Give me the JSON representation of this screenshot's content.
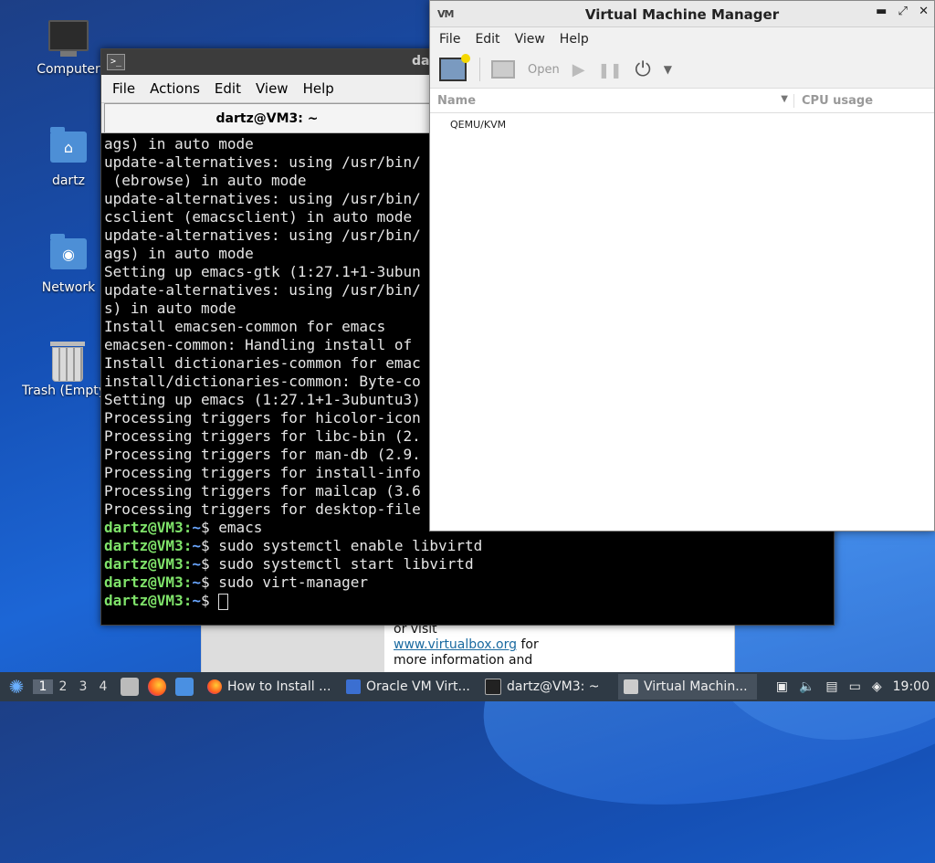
{
  "desktop": {
    "icons": [
      {
        "label": "Computer"
      },
      {
        "label": "dartz"
      },
      {
        "label": "Network"
      },
      {
        "label": "Trash (Empty)"
      }
    ]
  },
  "terminal": {
    "window_title": "dartz@VM3: ~",
    "titlebar_partial": "da",
    "menu": [
      "File",
      "Actions",
      "Edit",
      "View",
      "Help"
    ],
    "tab_title": "dartz@VM3: ~",
    "output_lines": [
      "ags) in auto mode",
      "update-alternatives: using /usr/bin/",
      " (ebrowse) in auto mode",
      "update-alternatives: using /usr/bin/",
      "csclient (emacsclient) in auto mode",
      "update-alternatives: using /usr/bin/",
      "ags) in auto mode",
      "Setting up emacs-gtk (1:27.1+1-3ubun",
      "update-alternatives: using /usr/bin/",
      "s) in auto mode",
      "Install emacsen-common for emacs",
      "emacsen-common: Handling install of",
      "Install dictionaries-common for emac",
      "install/dictionaries-common: Byte-co",
      "Setting up emacs (1:27.1+1-3ubuntu3)",
      "Processing triggers for hicolor-icon",
      "Processing triggers for libc-bin (2.",
      "Processing triggers for man-db (2.9.",
      "Processing triggers for install-info",
      "Processing triggers for mailcap (3.6",
      "Processing triggers for desktop-file"
    ],
    "prompt_user": "dartz@VM3",
    "prompt_sep": ":",
    "prompt_dir": "~",
    "prompt_symbol": "$",
    "commands": [
      "emacs",
      "sudo systemctl enable libvirtd",
      "sudo systemctl start libvirtd",
      "sudo virt-manager"
    ]
  },
  "browser_fragment": {
    "line1": "or visit",
    "link": "www.virtualbox.org",
    "line2_suffix": " for",
    "line3": "more information and"
  },
  "virt_manager": {
    "title": "Virtual Machine Manager",
    "menu": [
      "File",
      "Edit",
      "View",
      "Help"
    ],
    "toolbar": {
      "open_label": "Open"
    },
    "columns": {
      "name": "Name",
      "cpu": "CPU usage"
    },
    "connections": [
      "QEMU/KVM"
    ]
  },
  "taskbar": {
    "workspaces": [
      "1",
      "2",
      "3",
      "4"
    ],
    "active_workspace": "1",
    "tasks": [
      {
        "label": "How to Install ...",
        "icon": "firefox-icon"
      },
      {
        "label": "Oracle VM Virt...",
        "icon": "virtualbox-icon"
      },
      {
        "label": "dartz@VM3: ~",
        "icon": "terminal-icon"
      },
      {
        "label": "Virtual Machin...",
        "icon": "virt-manager-icon"
      }
    ],
    "clock": "19:00"
  }
}
